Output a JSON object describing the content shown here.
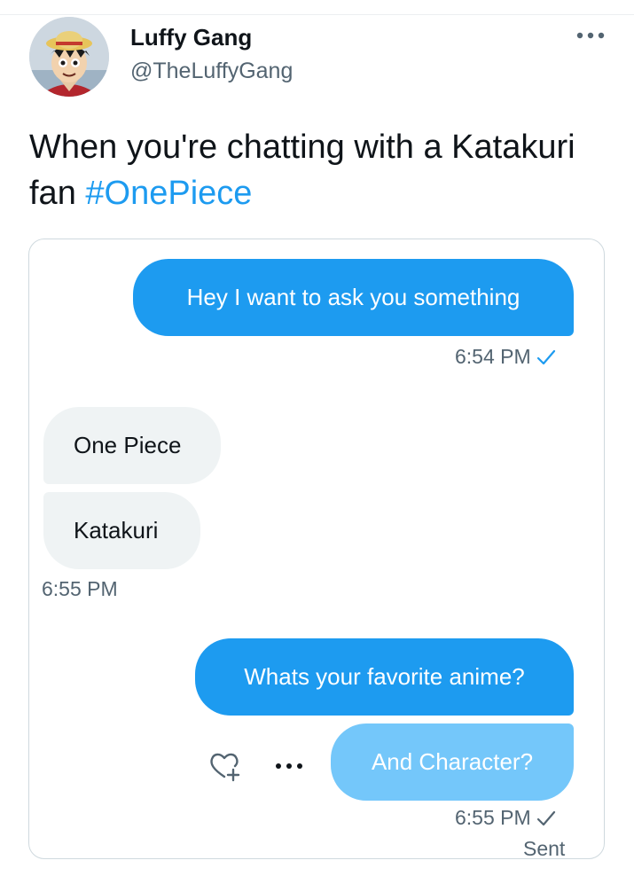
{
  "tweet": {
    "author_name": "Luffy Gang",
    "author_handle": "@TheLuffyGang",
    "avatar_icon": "luffy-straw-hat-avatar",
    "text": "When you're chatting with a Katakuri fan",
    "hashtag": "#OnePiece",
    "more_icon": "more-horizontal-icon"
  },
  "chat": {
    "messages": [
      {
        "side": "sent",
        "text": "Hey I want to ask you something"
      },
      {
        "side": "received",
        "text": "One Piece"
      },
      {
        "side": "received",
        "text": "Katakuri"
      },
      {
        "side": "sent",
        "text": "Whats your favorite anime?"
      },
      {
        "side": "sent",
        "text": "And Character?"
      }
    ],
    "timestamps": {
      "first_sent": "6:54 PM",
      "received": "6:55 PM",
      "last_sent": "6:55 PM"
    },
    "status": "Sent",
    "icons": {
      "check": "checkmark-icon",
      "react": "add-reaction-heart-icon",
      "more": "more-options-icon"
    }
  },
  "colors": {
    "accent": "#1d9bf0",
    "bubble_sent": "#1d9bf0",
    "bubble_sending": "#74c7fa",
    "bubble_received": "#eff3f4",
    "secondary_text": "#536471",
    "primary_text": "#0f1419"
  }
}
